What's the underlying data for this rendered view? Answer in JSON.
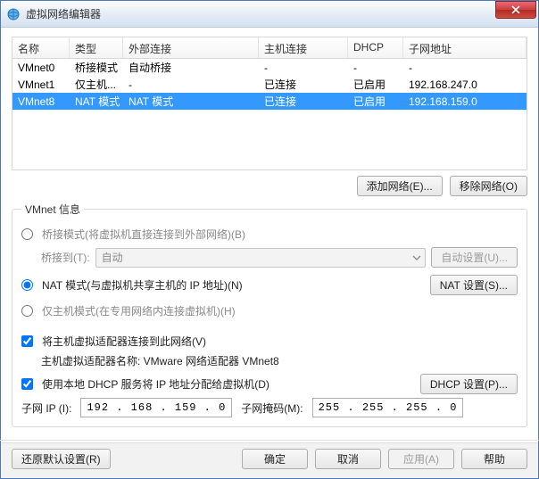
{
  "window": {
    "title": "虚拟网络编辑器"
  },
  "table": {
    "headers": [
      "名称",
      "类型",
      "外部连接",
      "主机连接",
      "DHCP",
      "子网地址"
    ],
    "rows": [
      {
        "cells": [
          "VMnet0",
          "桥接模式",
          "自动桥接",
          "-",
          "-",
          "-"
        ],
        "selected": false
      },
      {
        "cells": [
          "VMnet1",
          "仅主机...",
          "-",
          "已连接",
          "已启用",
          "192.168.247.0"
        ],
        "selected": false
      },
      {
        "cells": [
          "VMnet8",
          "NAT 模式",
          "NAT 模式",
          "已连接",
          "已启用",
          "192.168.159.0"
        ],
        "selected": true
      }
    ]
  },
  "buttons": {
    "add_network": "添加网络(E)...",
    "remove_network": "移除网络(O)",
    "auto_settings": "自动设置(U)...",
    "nat_settings": "NAT 设置(S)...",
    "dhcp_settings": "DHCP 设置(P)...",
    "restore": "还原默认设置(R)",
    "ok": "确定",
    "cancel": "取消",
    "apply": "应用(A)",
    "help": "帮助"
  },
  "info": {
    "legend": "VMnet 信息",
    "bridged_label": "桥接模式(将虚拟机直接连接到外部网络)(B)",
    "bridged_to": "桥接到(T):",
    "bridged_combo": "自动",
    "nat_label": "NAT 模式(与虚拟机共享主机的 IP 地址)(N)",
    "hostonly_label": "仅主机模式(在专用网络内连接虚拟机)(H)",
    "host_adapter_check": "将主机虚拟适配器连接到此网络(V)",
    "host_adapter_name_label": "主机虚拟适配器名称: VMware 网络适配器 VMnet8",
    "dhcp_check": "使用本地 DHCP 服务将 IP 地址分配给虚拟机(D)",
    "subnet_ip_label": "子网 IP (I):",
    "subnet_ip": "192 . 168 . 159 .  0",
    "subnet_mask_label": "子网掩码(M):",
    "subnet_mask": "255 . 255 . 255 .  0"
  }
}
